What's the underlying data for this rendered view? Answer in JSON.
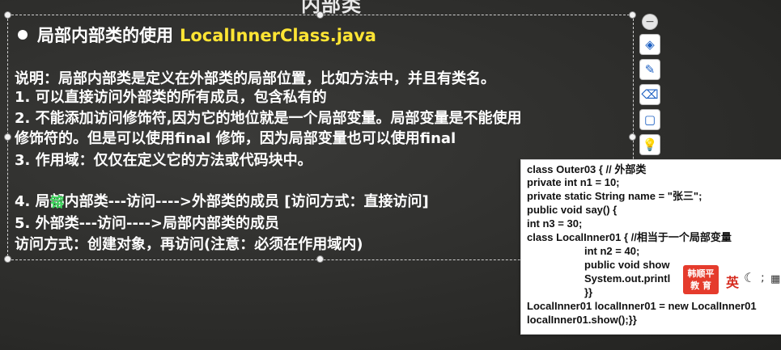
{
  "slide": {
    "top_title": "内部类",
    "heading_label": "局部内部类的使用",
    "heading_class": "LocalInnerClass.java",
    "lines": [
      "说明：局部内部类是定义在外部类的局部位置，比如方法中，并且有类名。",
      "1. 可以直接访问外部类的所有成员，包含私有的",
      "2. 不能添加访问修饰符,因为它的地位就是一个局部变量。局部变量是不能使用",
      "    修饰符的。但是可以使用final 修饰，因为局部变量也可以使用final",
      "3. 作用域：仅仅在定义它的方法或代码块中。",
      "4. 局部内部类---访问---->外部类的成员 [访问方式：直接访问]",
      "5. 外部类---访问---->局部内部类的成员",
      "    访问方式：创建对象，再访问(注意：必须在作用域内)"
    ],
    "green_mark": "镕"
  },
  "toolbar": {
    "items": [
      {
        "name": "collapse",
        "glyph": "−"
      },
      {
        "name": "layers",
        "glyph": "◈"
      },
      {
        "name": "pen",
        "glyph": "✎"
      },
      {
        "name": "eraser",
        "glyph": "⌫"
      },
      {
        "name": "frame",
        "glyph": "▢"
      },
      {
        "name": "lightbulb",
        "glyph": "💡"
      }
    ],
    "more": "..."
  },
  "code": {
    "lines": [
      "class Outer03 { // 外部类",
      "private int n1 = 10;",
      "private static String name = \"张三\";",
      "public void say() {",
      "int n3 = 30;",
      "class LocalInner01 { //相当于一个局部变量",
      "int n2 = 40;",
      "public void show",
      "System.out.printl",
      "}}",
      "LocalInner01 localInner01 = new LocalInner01",
      "localInner01.show();}}"
    ]
  },
  "overlay": {
    "stamp_line1": "韩顺平",
    "stamp_line2": "教 育",
    "lang": "英",
    "moon": "☾",
    "semi": ";",
    "keyboard": "▦"
  }
}
